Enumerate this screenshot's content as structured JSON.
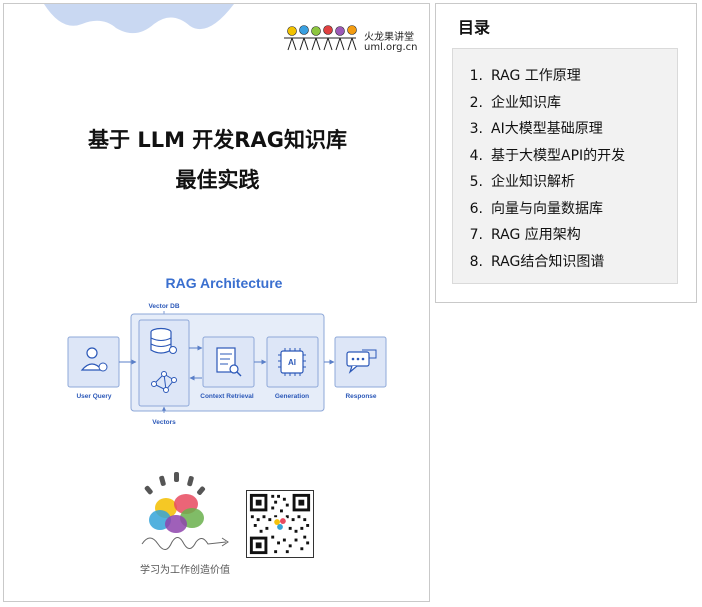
{
  "brand": {
    "name_cn": "火龙果讲堂",
    "site": "uml.org.cn",
    "slogan": "学习为工作创造价值"
  },
  "cover": {
    "title_line1": "基于 LLM 开发RAG知识库",
    "title_line2": "最佳实践"
  },
  "diagram": {
    "title": "RAG Architecture",
    "labels": {
      "vector_db": "Vector DB",
      "vectors": "Vectors",
      "user_query": "User Query",
      "context_retrieval": "Context Retrieval",
      "generation": "Generation",
      "response": "Response",
      "ai_chip": "AI"
    }
  },
  "toc": {
    "title": "目录",
    "items": [
      {
        "num": "1.",
        "label": "RAG 工作原理"
      },
      {
        "num": "2.",
        "label": "企业知识库"
      },
      {
        "num": "3.",
        "label": "AI大模型基础原理"
      },
      {
        "num": "4.",
        "label": "基于大模型API的开发"
      },
      {
        "num": "5.",
        "label": "企业知识解析"
      },
      {
        "num": "6.",
        "label": "向量与向量数据库"
      },
      {
        "num": "7.",
        "label": "RAG 应用架构"
      },
      {
        "num": "8.",
        "label": "RAG结合知识图谱"
      }
    ]
  },
  "colors": {
    "diagram_title": "#3a6fcf",
    "diagram_fill": "#dde6f7",
    "diagram_stroke": "#8ea8d8",
    "diagram_text": "#2b58b8",
    "wave": "#c9d8f2"
  }
}
